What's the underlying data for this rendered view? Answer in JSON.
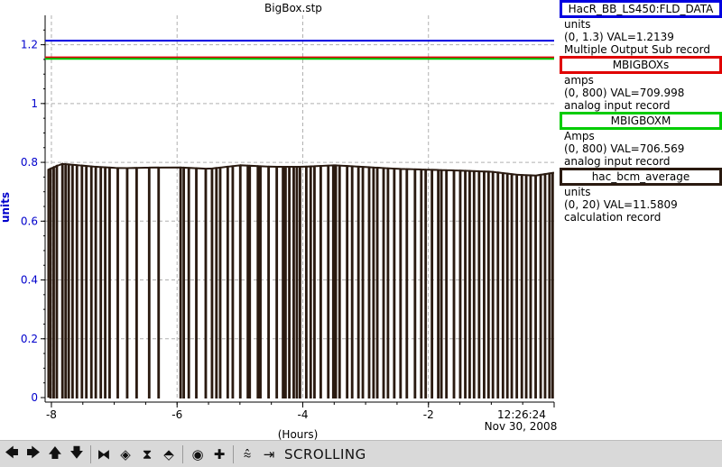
{
  "chart_data": {
    "type": "line",
    "title": "BigBox.stp",
    "xlabel": "(Hours)",
    "ylabel": "units",
    "xlim": [
      -8.1,
      0
    ],
    "ylim": [
      0,
      1.3
    ],
    "x_ticks": [
      -8,
      -6,
      -4,
      -2
    ],
    "x_tick_labels": [
      "-8",
      "-6",
      "-4",
      "-2"
    ],
    "y_ticks": [
      0,
      0.2,
      0.4,
      0.6,
      0.8,
      1,
      1.2
    ],
    "y_tick_labels": [
      "0",
      "0.2",
      "0.4",
      "0.6",
      "0.8",
      "1",
      "1.2"
    ],
    "end_time": "12:26:24",
    "end_date": "Nov 30, 2008",
    "grid": true,
    "series": [
      {
        "name": "HacR_BB_LS450:FLD_DATA",
        "color": "#0000e0",
        "y": 1.2139,
        "style": "flat"
      },
      {
        "name": "MBIGBOXs",
        "color": "#e00000",
        "y": 1.157,
        "style": "flat"
      },
      {
        "name": "MBIGBOXM",
        "color": "#00cc00",
        "y": 1.152,
        "style": "flat"
      },
      {
        "name": "hac_bcm_average",
        "color": "#2a1a10",
        "style": "pulsed",
        "baseline": [
          [
            -8.05,
            0.775
          ],
          [
            -7.85,
            0.795
          ],
          [
            -7.3,
            0.785
          ],
          [
            -6.9,
            0.78
          ],
          [
            -6.5,
            0.782
          ],
          [
            -6.0,
            0.783
          ],
          [
            -5.5,
            0.778
          ],
          [
            -5.0,
            0.79
          ],
          [
            -4.5,
            0.785
          ],
          [
            -4.0,
            0.785
          ],
          [
            -3.5,
            0.79
          ],
          [
            -3.0,
            0.784
          ],
          [
            -2.5,
            0.778
          ],
          [
            -2.0,
            0.775
          ],
          [
            -1.5,
            0.772
          ],
          [
            -1.0,
            0.768
          ],
          [
            -0.6,
            0.758
          ],
          [
            -0.3,
            0.755
          ],
          [
            0.0,
            0.765
          ]
        ],
        "drop_times": [
          -8.02,
          -7.97,
          -7.92,
          -7.83,
          -7.78,
          -7.73,
          -7.67,
          -7.6,
          -7.52,
          -7.45,
          -7.37,
          -7.3,
          -7.22,
          -7.15,
          -7.08,
          -6.95,
          -6.8,
          -6.65,
          -6.45,
          -6.3,
          -5.95,
          -5.9,
          -5.82,
          -5.7,
          -5.55,
          -5.45,
          -5.38,
          -5.32,
          -5.2,
          -5.12,
          -5.0,
          -4.88,
          -4.85,
          -4.72,
          -4.68,
          -4.55,
          -4.42,
          -4.32,
          -4.28,
          -4.22,
          -4.15,
          -4.1,
          -4.05,
          -3.95,
          -3.88,
          -3.82,
          -3.72,
          -3.6,
          -3.52,
          -3.48,
          -3.42,
          -3.3,
          -3.22,
          -3.12,
          -3.05,
          -2.95,
          -2.88,
          -2.82,
          -2.72,
          -2.65,
          -2.55,
          -2.45,
          -2.35,
          -2.22,
          -2.12,
          -2.05,
          -1.95,
          -1.85,
          -1.8,
          -1.72,
          -1.6,
          -1.5,
          -1.42,
          -1.35,
          -1.28,
          -1.2,
          -1.12,
          -1.05,
          -0.98,
          -0.9,
          -0.82,
          -0.75,
          -0.68,
          -0.6,
          -0.52,
          -0.45,
          -0.38,
          -0.3,
          -0.22,
          -0.15,
          -0.08,
          -0.03
        ]
      }
    ]
  },
  "legend": [
    {
      "name": "HacR_BB_LS450:FLD_DATA",
      "color": "#0000e0",
      "unit": "units",
      "range_val": "(0, 1.3) VAL=1.2139",
      "record": "Multiple Output Sub record"
    },
    {
      "name": "MBIGBOXs",
      "color": "#e00000",
      "unit": "amps",
      "range_val": "(0, 800) VAL=709.998",
      "record": "analog input record"
    },
    {
      "name": "MBIGBOXM",
      "color": "#00cc00",
      "unit": "Amps",
      "range_val": "(0, 800) VAL=706.569",
      "record": "analog input record"
    },
    {
      "name": "hac_bcm_average",
      "color": "#2a1a10",
      "unit": "units",
      "range_val": "(0, 20) VAL=11.5809",
      "record": "calculation record"
    }
  ],
  "toolbar": {
    "status": "SCROLLING",
    "buttons": [
      {
        "icon": "arrow-left-icon",
        "glyph": "🡄"
      },
      {
        "icon": "arrow-right-icon",
        "glyph": "🡆"
      },
      {
        "icon": "arrow-up-icon",
        "glyph": "🡅"
      },
      {
        "icon": "arrow-down-icon",
        "glyph": "🡇"
      },
      {
        "icon": "zoom-in-horizontal-icon",
        "glyph": "⧓"
      },
      {
        "icon": "zoom-out-horizontal-icon",
        "glyph": "◈"
      },
      {
        "icon": "zoom-in-vertical-icon",
        "glyph": "⧗"
      },
      {
        "icon": "zoom-out-vertical-icon",
        "glyph": "⬘"
      },
      {
        "icon": "config-icon",
        "glyph": "◉"
      },
      {
        "icon": "add-pv-icon",
        "glyph": "✚"
      },
      {
        "icon": "auto-scale-icon",
        "glyph": "⩯"
      },
      {
        "icon": "scroll-mode-icon",
        "glyph": "⇥"
      }
    ]
  }
}
